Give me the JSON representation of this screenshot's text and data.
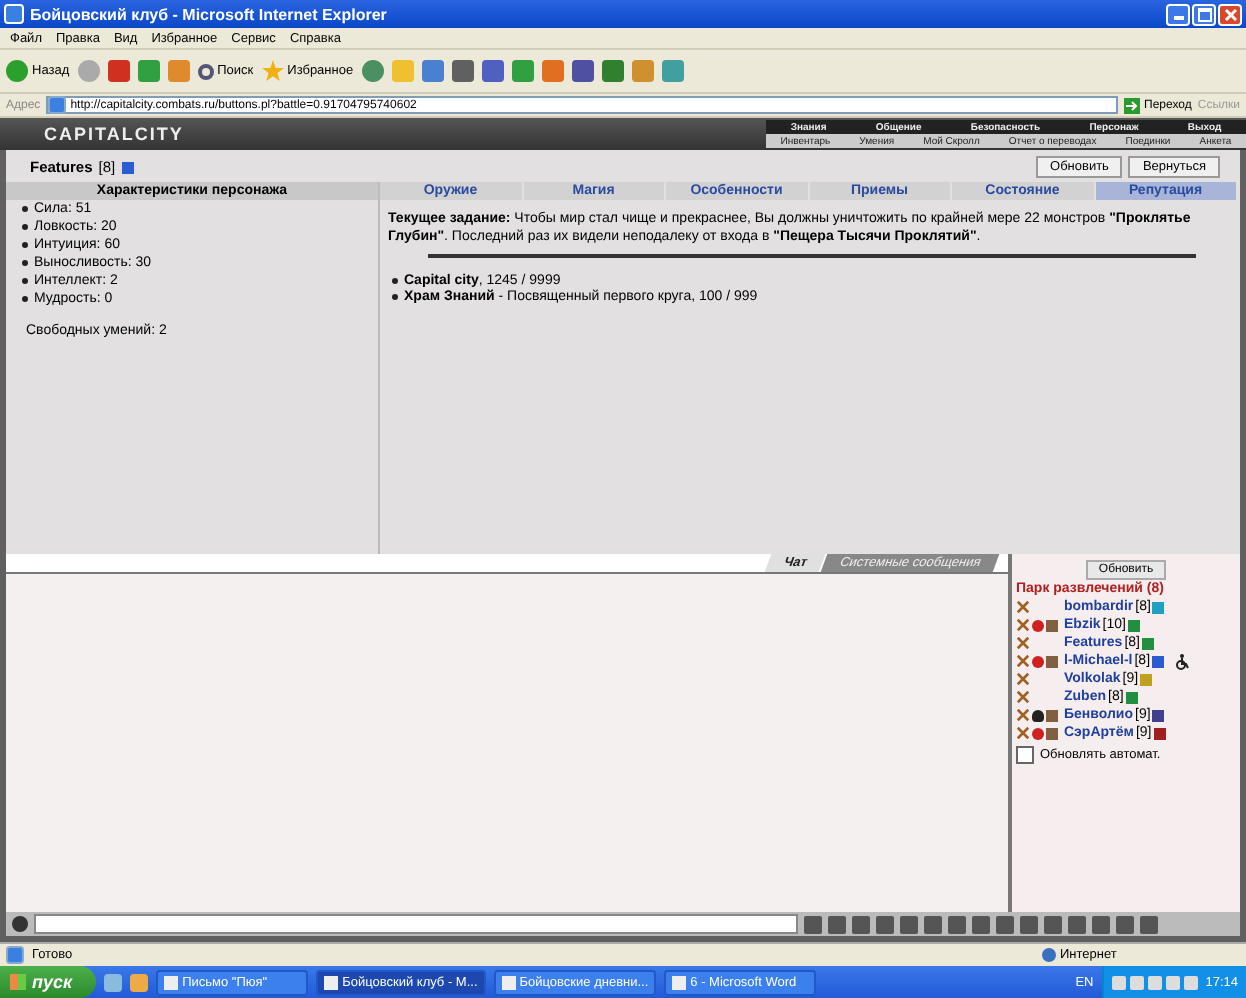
{
  "window": {
    "title": "Бойцовский клуб - Microsoft Internet Explorer"
  },
  "menu": [
    "Файл",
    "Правка",
    "Вид",
    "Избранное",
    "Сервис",
    "Справка"
  ],
  "toolbar": {
    "back": "Назад",
    "search": "Поиск",
    "favorites": "Избранное"
  },
  "address": {
    "label": "Адрес",
    "url": "http://capitalcity.combats.ru/buttons.pl?battle=0.91704795740602",
    "go": "Переход",
    "links": "Ссылки"
  },
  "game": {
    "logo": "CAPITALCITY",
    "nav_top": [
      "Знания",
      "Общение",
      "Безопасность",
      "Персонаж",
      "Выход"
    ],
    "nav_bottom": [
      "Инвентарь",
      "Умения",
      "Мой Скролл",
      "Отчет о переводах",
      "Поединки",
      "Анкета"
    ],
    "character": {
      "name": "Features",
      "level": "[8]",
      "color": "#2a5bd0"
    },
    "buttons": [
      "Обновить",
      "Вернуться"
    ],
    "stats_title": "Характеристики персонажа",
    "stats": [
      "Сила: 51",
      "Ловкость: 20",
      "Интуиция: 60",
      "Выносливость: 30",
      "Интеллект: 2",
      "Мудрость: 0"
    ],
    "free_skills": "Свободных умений: 2",
    "tabs": [
      {
        "label": "Оружие",
        "selected": false
      },
      {
        "label": "Магия",
        "selected": false
      },
      {
        "label": "Особенности",
        "selected": false
      },
      {
        "label": "Приемы",
        "selected": false
      },
      {
        "label": "Состояние",
        "selected": false
      },
      {
        "label": "Репутация",
        "selected": true
      }
    ],
    "quest": "**Текущее задание:** Чтобы мир стал чище и прекраснее, Вы должны уничтожить по крайней мере 22 монстров **\"Проклятье Глубин\"**. Последний раз их видели неподалеку от входа в **\"Пещера Тысячи Проклятий\"**.",
    "reputation": [
      "**Capital city**, 1245 / 9999",
      "**Храм Знаний** - Посвященный первого круга, 100 / 999"
    ]
  },
  "chat": {
    "tabs": [
      {
        "label": "Чат",
        "selected": true
      },
      {
        "label": "Системные сообщения",
        "selected": false
      }
    ],
    "refresh": "Обновить",
    "location": "Парк развлечений (8)",
    "users": [
      {
        "name": "bombardir",
        "level": "[8]",
        "color": "#20a0c0",
        "swords": true,
        "dot": false,
        "emblem": false,
        "figure": false,
        "wheelchair": false
      },
      {
        "name": "Ebzik",
        "level": "[10]",
        "color": "#209040",
        "swords": true,
        "dot": true,
        "emblem": true,
        "figure": false,
        "wheelchair": false
      },
      {
        "name": "Features",
        "level": "[8]",
        "color": "#209040",
        "swords": true,
        "dot": false,
        "emblem": false,
        "figure": false,
        "wheelchair": false
      },
      {
        "name": "l-Michael-l",
        "level": "[8]",
        "color": "#2a5bd0",
        "swords": true,
        "dot": true,
        "emblem": true,
        "figure": false,
        "wheelchair": true
      },
      {
        "name": "Volkolak",
        "level": "[9]",
        "color": "#c0a020",
        "swords": true,
        "dot": false,
        "emblem": false,
        "figure": false,
        "wheelchair": false
      },
      {
        "name": "Zuben",
        "level": "[8]",
        "color": "#209040",
        "swords": true,
        "dot": false,
        "emblem": false,
        "figure": false,
        "wheelchair": false
      },
      {
        "name": "Бенволио",
        "level": "[9]",
        "color": "#404090",
        "swords": true,
        "dot": false,
        "emblem": true,
        "figure": true,
        "wheelchair": false
      },
      {
        "name": "СэрАртём",
        "level": "[9]",
        "color": "#a02020",
        "swords": true,
        "dot": true,
        "emblem": true,
        "figure": false,
        "wheelchair": false
      }
    ],
    "auto_refresh": {
      "label": "Обновлять автомат.",
      "checked": false
    }
  },
  "status": {
    "text": "Готово",
    "zone": "Интернет"
  },
  "taskbar": {
    "start": "пуск",
    "tasks": [
      {
        "label": "Письмо \"Пюя\"",
        "selected": false
      },
      {
        "label": "Бойцовский клуб - М...",
        "selected": true
      },
      {
        "label": "Бойцовские дневни...",
        "selected": false
      },
      {
        "label": "6 - Microsoft Word",
        "selected": false
      }
    ],
    "lang": "EN",
    "clock": "17:14"
  }
}
